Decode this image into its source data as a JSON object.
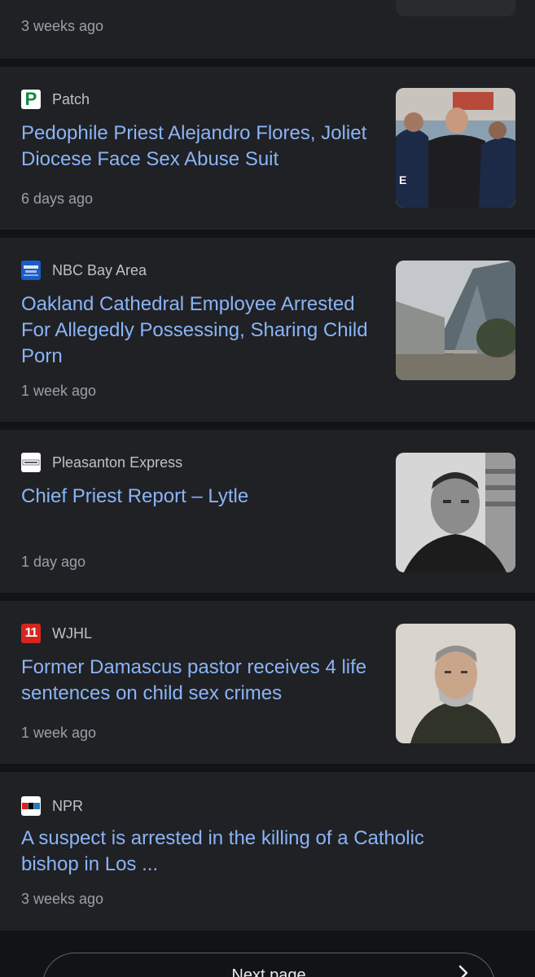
{
  "articles": [
    {
      "time": "3 weeks ago"
    },
    {
      "source": "Patch",
      "title": "Pedophile Priest Alejandro Flores, Joliet Diocese Face Sex Abuse Suit",
      "time": "6 days ago",
      "favicon_icon": "patch-logo-icon",
      "favicon_letter": "P",
      "favicon_color": "#0a8a3a"
    },
    {
      "source": "NBC Bay Area",
      "title": "Oakland Cathedral Employee Arrested For Allegedly Possessing, Sharing Child Porn",
      "time": "1 week ago",
      "favicon_icon": "nbc-bay-area-logo-icon",
      "favicon_color": "#1a5cc8"
    },
    {
      "source": "Pleasanton Express",
      "title": "Chief Priest Report – Lytle",
      "time": "1 day ago",
      "favicon_icon": "pleasanton-express-logo-icon",
      "favicon_color": "#ffffff"
    },
    {
      "source": "WJHL",
      "title": "Former Damascus pastor receives 4 life sentences on child sex crimes",
      "time": "1 week ago",
      "favicon_icon": "wjhl-logo-icon",
      "favicon_letter": "11",
      "favicon_color": "#d5261e"
    },
    {
      "source": "NPR",
      "title": "A suspect is arrested in the killing of a Catholic bishop in Los ...",
      "time": "3 weeks ago",
      "favicon_icon": "npr-logo-icon",
      "favicon_color": "#ffffff"
    }
  ],
  "pagination": {
    "next_label": "Next page"
  },
  "colors": {
    "background": "#121316",
    "card": "#202124",
    "headline": "#8ab4f8",
    "source": "#bdc1c6",
    "timestamp": "#9aa0a6"
  }
}
